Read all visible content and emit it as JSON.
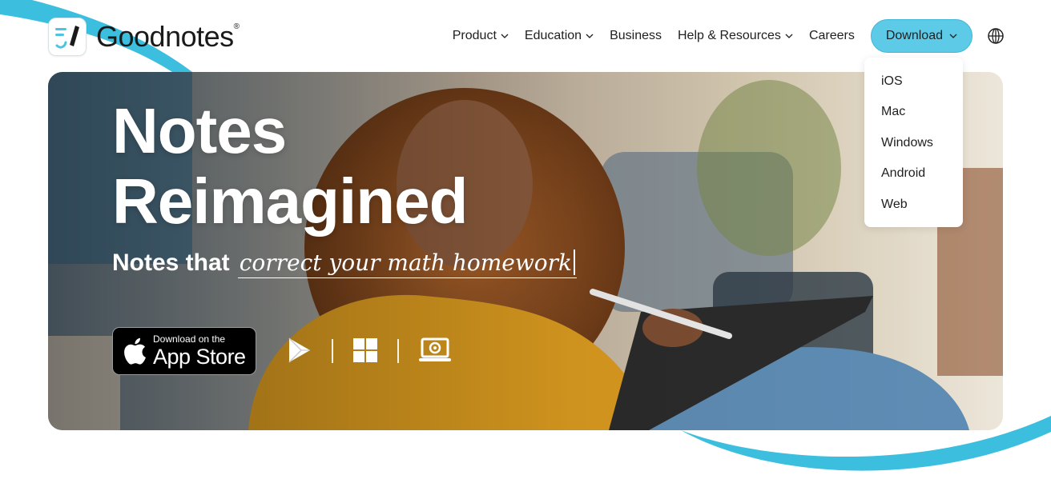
{
  "brand": {
    "name": "Goodnotes",
    "reg_mark": "®",
    "accent": "#5dcbe8",
    "swoosh_color": "#3cbfdf"
  },
  "nav": {
    "items": [
      {
        "label": "Product",
        "has_dropdown": true
      },
      {
        "label": "Education",
        "has_dropdown": true
      },
      {
        "label": "Business",
        "has_dropdown": false
      },
      {
        "label": "Help & Resources",
        "has_dropdown": true
      },
      {
        "label": "Careers",
        "has_dropdown": false
      }
    ],
    "download_label": "Download",
    "language_icon": "globe-icon"
  },
  "download_menu": {
    "open": true,
    "options": [
      "iOS",
      "Mac",
      "Windows",
      "Android",
      "Web"
    ]
  },
  "hero": {
    "headline_line1": "Notes",
    "headline_line2": "Reimagined",
    "subline_prefix": "Notes that",
    "subline_typed": "correct your math homework",
    "app_store_small": "Download on the",
    "app_store_big": "App Store",
    "platform_icons": [
      "google-play-icon",
      "windows-icon",
      "chromebook-icon"
    ]
  }
}
